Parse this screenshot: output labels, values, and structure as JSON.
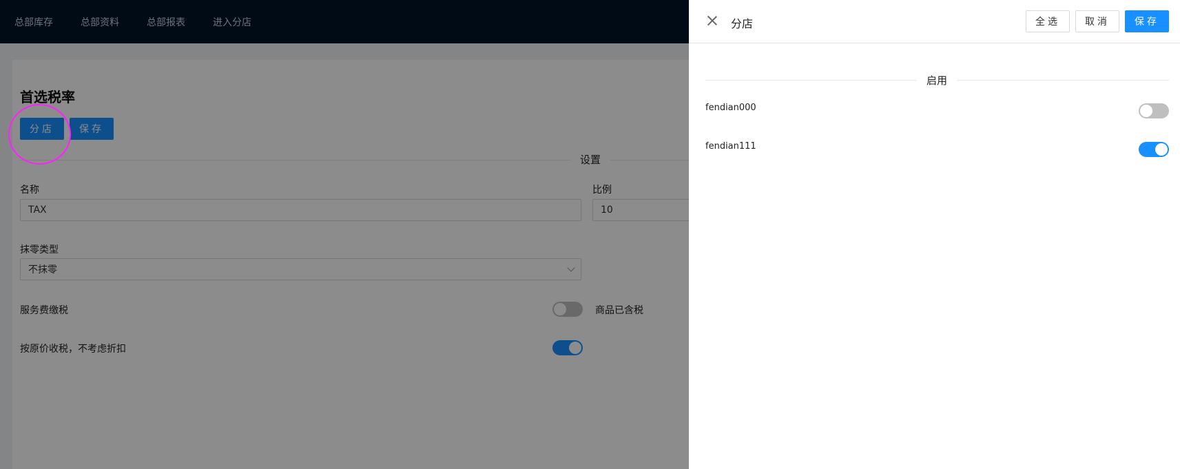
{
  "topnav": {
    "items": [
      "总部库存",
      "总部资料",
      "总部报表",
      "进入分店"
    ]
  },
  "page": {
    "title": "首选税率",
    "branch_button": "分店",
    "save_button": "保存",
    "section_label": "设置",
    "name_label": "名称",
    "name_value": "TAX",
    "ratio_label": "比例",
    "ratio_value": "10",
    "rounding_label": "抹零类型",
    "rounding_value": "不抹零",
    "service_tax_label": "服务费缴税",
    "service_tax_on": false,
    "price_includes_tax_label": "商品已含税",
    "original_price_tax_label": "按原价收税，不考虑折扣",
    "original_price_tax_on": true
  },
  "drawer": {
    "title": "分店",
    "select_all": "全选",
    "cancel": "取消",
    "save": "保存",
    "section_label": "启用",
    "branches": [
      {
        "name": "fendian000",
        "enabled": false
      },
      {
        "name": "fendian111",
        "enabled": true
      }
    ]
  },
  "colors": {
    "accent": "#1890ff",
    "nav_bg": "#001529",
    "highlight": "#ff1fff"
  }
}
